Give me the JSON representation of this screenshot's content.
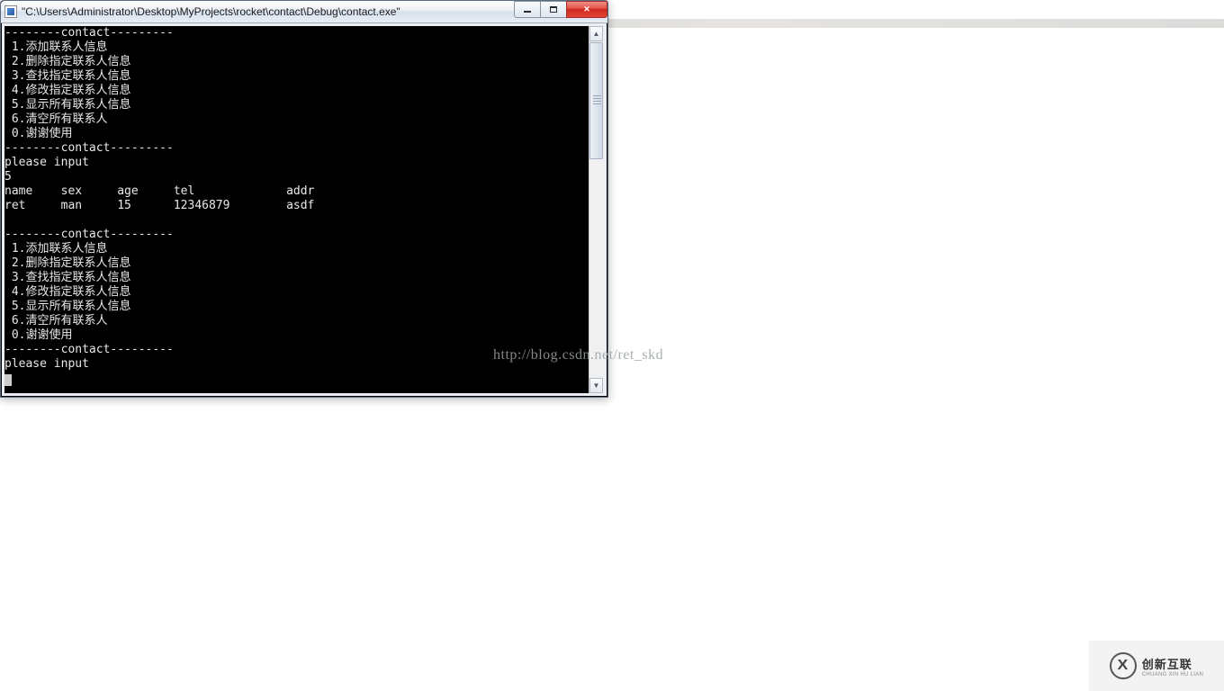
{
  "window": {
    "title": "\"C:\\Users\\Administrator\\Desktop\\MyProjects\\rocket\\contact\\Debug\\contact.exe\""
  },
  "console": {
    "banner": "--------contact---------",
    "menu": {
      "m1": " 1.添加联系人信息",
      "m2": " 2.删除指定联系人信息",
      "m3": " 3.查找指定联系人信息",
      "m4": " 4.修改指定联系人信息",
      "m5": " 5.显示所有联系人信息",
      "m6": " 6.清空所有联系人",
      "m0": " 0.谢谢使用"
    },
    "prompt": "please input",
    "input_value": "5",
    "table": {
      "header": "name    sex     age     tel             addr",
      "row1": "ret     man     15      12346879        asdf"
    }
  },
  "watermark": "http://blog.csdn.net/ret_skd",
  "footer": {
    "cn": "创新互联",
    "en": "CHUANG XIN HU LIAN"
  }
}
